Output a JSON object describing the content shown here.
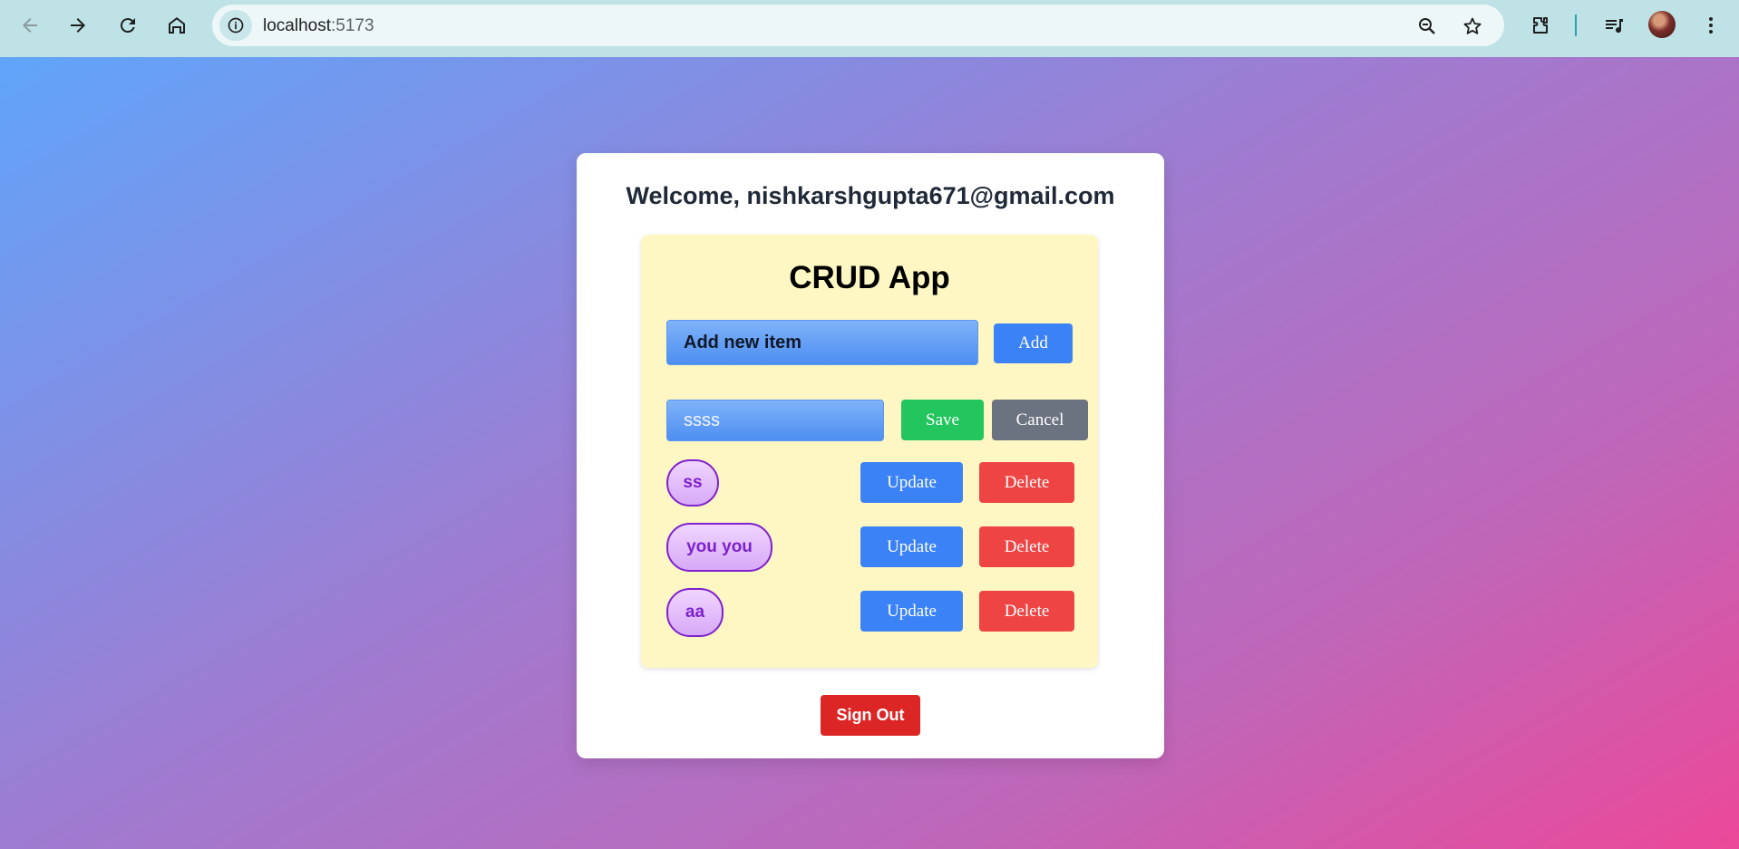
{
  "browser": {
    "url_host": "localhost",
    "url_port": ":5173",
    "icons": [
      "back-icon",
      "forward-icon",
      "reload-icon",
      "home-icon",
      "site-info-icon",
      "zoom-icon",
      "bookmark-star-icon",
      "extensions-icon",
      "media-controls-icon",
      "profile-avatar",
      "more-menu-icon"
    ]
  },
  "page": {
    "welcome": "Welcome, nishkarshgupta671@gmail.com",
    "crud": {
      "title": "CRUD App",
      "add_input_value": "Add new item",
      "add_label": "Add",
      "edit": {
        "value": "ssss",
        "save_label": "Save",
        "cancel_label": "Cancel"
      },
      "items": [
        {
          "text": "ss",
          "update_label": "Update",
          "delete_label": "Delete"
        },
        {
          "text": "you you",
          "update_label": "Update",
          "delete_label": "Delete"
        },
        {
          "text": "aa",
          "update_label": "Update",
          "delete_label": "Delete"
        }
      ]
    },
    "signout_label": "Sign Out"
  },
  "colors": {
    "gradient_start": "#60a5fa",
    "gradient_end": "#ec4899",
    "panel_bg": "#fef7c3",
    "update_blue": "#3b82f6",
    "save_green": "#22c55e",
    "cancel_gray": "#6b7280",
    "delete_red": "#ef4444",
    "signout_red": "#dc2626",
    "pill_purple": "#7e22ce"
  }
}
